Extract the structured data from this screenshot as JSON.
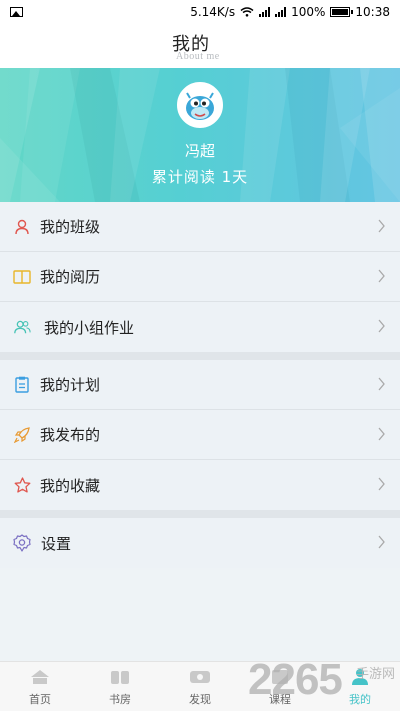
{
  "status_bar": {
    "speed": "5.14K/s",
    "battery": "100%",
    "time": "10:38"
  },
  "title": {
    "cn": "我的",
    "en": "About me"
  },
  "profile": {
    "name": "冯超",
    "reading": "累计阅读  1天"
  },
  "menu_group_1": [
    {
      "label": "我的班级",
      "icon": "user-icon",
      "color": "#e0574f"
    },
    {
      "label": "我的阅历",
      "icon": "book-icon",
      "color": "#e8b62a"
    },
    {
      "label": "我的小组作业",
      "icon": "group-icon",
      "color": "#45c3b5"
    }
  ],
  "menu_group_2": [
    {
      "label": "我的计划",
      "icon": "clipboard-icon",
      "color": "#3b9ee0"
    },
    {
      "label": "我发布的",
      "icon": "rocket-icon",
      "color": "#e89a33"
    },
    {
      "label": "我的收藏",
      "icon": "star-icon",
      "color": "#e0574f"
    }
  ],
  "menu_group_3": [
    {
      "label": "设置",
      "icon": "gear-icon",
      "color": "#7a6fc2"
    }
  ],
  "bottom_nav": [
    {
      "label": "首页",
      "icon": "home-icon"
    },
    {
      "label": "书房",
      "icon": "bookshelf-icon"
    },
    {
      "label": "发现",
      "icon": "discover-icon"
    },
    {
      "label": "课程",
      "icon": "course-icon"
    },
    {
      "label": "我的",
      "icon": "me-icon",
      "active": true
    }
  ],
  "watermark": {
    "number": "2265",
    "site": "手游网"
  },
  "colors": {
    "accent": "#45c3c8",
    "banner_start": "#62d7c7",
    "banner_end": "#64c4e3"
  }
}
